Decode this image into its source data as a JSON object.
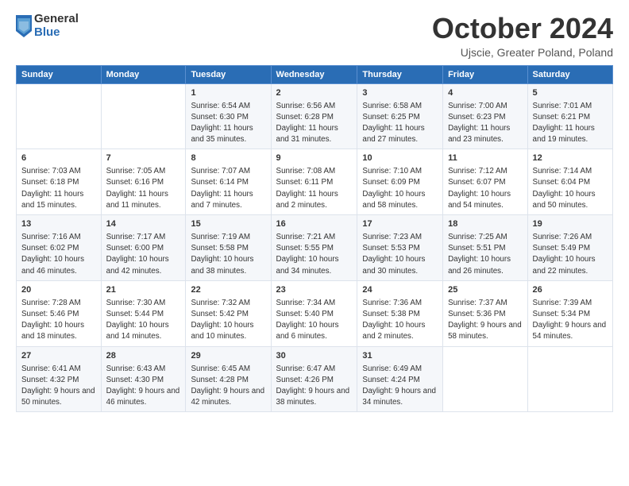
{
  "logo": {
    "general": "General",
    "blue": "Blue"
  },
  "header": {
    "month": "October 2024",
    "location": "Ujscie, Greater Poland, Poland"
  },
  "weekdays": [
    "Sunday",
    "Monday",
    "Tuesday",
    "Wednesday",
    "Thursday",
    "Friday",
    "Saturday"
  ],
  "weeks": [
    [
      {
        "day": "",
        "sunrise": "",
        "sunset": "",
        "daylight": ""
      },
      {
        "day": "",
        "sunrise": "",
        "sunset": "",
        "daylight": ""
      },
      {
        "day": "1",
        "sunrise": "Sunrise: 6:54 AM",
        "sunset": "Sunset: 6:30 PM",
        "daylight": "Daylight: 11 hours and 35 minutes."
      },
      {
        "day": "2",
        "sunrise": "Sunrise: 6:56 AM",
        "sunset": "Sunset: 6:28 PM",
        "daylight": "Daylight: 11 hours and 31 minutes."
      },
      {
        "day": "3",
        "sunrise": "Sunrise: 6:58 AM",
        "sunset": "Sunset: 6:25 PM",
        "daylight": "Daylight: 11 hours and 27 minutes."
      },
      {
        "day": "4",
        "sunrise": "Sunrise: 7:00 AM",
        "sunset": "Sunset: 6:23 PM",
        "daylight": "Daylight: 11 hours and 23 minutes."
      },
      {
        "day": "5",
        "sunrise": "Sunrise: 7:01 AM",
        "sunset": "Sunset: 6:21 PM",
        "daylight": "Daylight: 11 hours and 19 minutes."
      }
    ],
    [
      {
        "day": "6",
        "sunrise": "Sunrise: 7:03 AM",
        "sunset": "Sunset: 6:18 PM",
        "daylight": "Daylight: 11 hours and 15 minutes."
      },
      {
        "day": "7",
        "sunrise": "Sunrise: 7:05 AM",
        "sunset": "Sunset: 6:16 PM",
        "daylight": "Daylight: 11 hours and 11 minutes."
      },
      {
        "day": "8",
        "sunrise": "Sunrise: 7:07 AM",
        "sunset": "Sunset: 6:14 PM",
        "daylight": "Daylight: 11 hours and 7 minutes."
      },
      {
        "day": "9",
        "sunrise": "Sunrise: 7:08 AM",
        "sunset": "Sunset: 6:11 PM",
        "daylight": "Daylight: 11 hours and 2 minutes."
      },
      {
        "day": "10",
        "sunrise": "Sunrise: 7:10 AM",
        "sunset": "Sunset: 6:09 PM",
        "daylight": "Daylight: 10 hours and 58 minutes."
      },
      {
        "day": "11",
        "sunrise": "Sunrise: 7:12 AM",
        "sunset": "Sunset: 6:07 PM",
        "daylight": "Daylight: 10 hours and 54 minutes."
      },
      {
        "day": "12",
        "sunrise": "Sunrise: 7:14 AM",
        "sunset": "Sunset: 6:04 PM",
        "daylight": "Daylight: 10 hours and 50 minutes."
      }
    ],
    [
      {
        "day": "13",
        "sunrise": "Sunrise: 7:16 AM",
        "sunset": "Sunset: 6:02 PM",
        "daylight": "Daylight: 10 hours and 46 minutes."
      },
      {
        "day": "14",
        "sunrise": "Sunrise: 7:17 AM",
        "sunset": "Sunset: 6:00 PM",
        "daylight": "Daylight: 10 hours and 42 minutes."
      },
      {
        "day": "15",
        "sunrise": "Sunrise: 7:19 AM",
        "sunset": "Sunset: 5:58 PM",
        "daylight": "Daylight: 10 hours and 38 minutes."
      },
      {
        "day": "16",
        "sunrise": "Sunrise: 7:21 AM",
        "sunset": "Sunset: 5:55 PM",
        "daylight": "Daylight: 10 hours and 34 minutes."
      },
      {
        "day": "17",
        "sunrise": "Sunrise: 7:23 AM",
        "sunset": "Sunset: 5:53 PM",
        "daylight": "Daylight: 10 hours and 30 minutes."
      },
      {
        "day": "18",
        "sunrise": "Sunrise: 7:25 AM",
        "sunset": "Sunset: 5:51 PM",
        "daylight": "Daylight: 10 hours and 26 minutes."
      },
      {
        "day": "19",
        "sunrise": "Sunrise: 7:26 AM",
        "sunset": "Sunset: 5:49 PM",
        "daylight": "Daylight: 10 hours and 22 minutes."
      }
    ],
    [
      {
        "day": "20",
        "sunrise": "Sunrise: 7:28 AM",
        "sunset": "Sunset: 5:46 PM",
        "daylight": "Daylight: 10 hours and 18 minutes."
      },
      {
        "day": "21",
        "sunrise": "Sunrise: 7:30 AM",
        "sunset": "Sunset: 5:44 PM",
        "daylight": "Daylight: 10 hours and 14 minutes."
      },
      {
        "day": "22",
        "sunrise": "Sunrise: 7:32 AM",
        "sunset": "Sunset: 5:42 PM",
        "daylight": "Daylight: 10 hours and 10 minutes."
      },
      {
        "day": "23",
        "sunrise": "Sunrise: 7:34 AM",
        "sunset": "Sunset: 5:40 PM",
        "daylight": "Daylight: 10 hours and 6 minutes."
      },
      {
        "day": "24",
        "sunrise": "Sunrise: 7:36 AM",
        "sunset": "Sunset: 5:38 PM",
        "daylight": "Daylight: 10 hours and 2 minutes."
      },
      {
        "day": "25",
        "sunrise": "Sunrise: 7:37 AM",
        "sunset": "Sunset: 5:36 PM",
        "daylight": "Daylight: 9 hours and 58 minutes."
      },
      {
        "day": "26",
        "sunrise": "Sunrise: 7:39 AM",
        "sunset": "Sunset: 5:34 PM",
        "daylight": "Daylight: 9 hours and 54 minutes."
      }
    ],
    [
      {
        "day": "27",
        "sunrise": "Sunrise: 6:41 AM",
        "sunset": "Sunset: 4:32 PM",
        "daylight": "Daylight: 9 hours and 50 minutes."
      },
      {
        "day": "28",
        "sunrise": "Sunrise: 6:43 AM",
        "sunset": "Sunset: 4:30 PM",
        "daylight": "Daylight: 9 hours and 46 minutes."
      },
      {
        "day": "29",
        "sunrise": "Sunrise: 6:45 AM",
        "sunset": "Sunset: 4:28 PM",
        "daylight": "Daylight: 9 hours and 42 minutes."
      },
      {
        "day": "30",
        "sunrise": "Sunrise: 6:47 AM",
        "sunset": "Sunset: 4:26 PM",
        "daylight": "Daylight: 9 hours and 38 minutes."
      },
      {
        "day": "31",
        "sunrise": "Sunrise: 6:49 AM",
        "sunset": "Sunset: 4:24 PM",
        "daylight": "Daylight: 9 hours and 34 minutes."
      },
      {
        "day": "",
        "sunrise": "",
        "sunset": "",
        "daylight": ""
      },
      {
        "day": "",
        "sunrise": "",
        "sunset": "",
        "daylight": ""
      }
    ]
  ]
}
